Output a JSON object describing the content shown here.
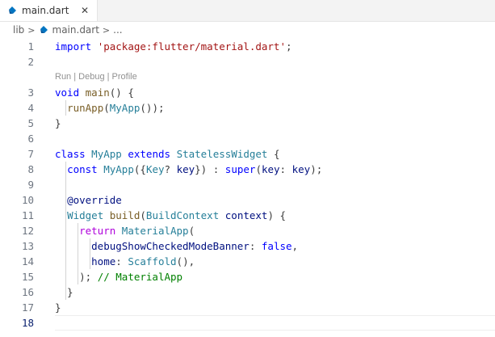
{
  "tab": {
    "filename": "main.dart",
    "icon": "dart-icon",
    "close_glyph": "✕"
  },
  "breadcrumb": {
    "folder": "lib",
    "sep1": ">",
    "file": "main.dart",
    "sep2": ">",
    "more": "..."
  },
  "codelens": "Run | Debug | Profile",
  "colors": {
    "keyword": "#0000ff",
    "control": "#af00db",
    "string": "#a31515",
    "type": "#267f99",
    "function": "#795e26",
    "variable": "#001080",
    "comment": "#008000",
    "dart": "#0175c2"
  },
  "lines": [
    {
      "n": "1",
      "t": [
        [
          "kw",
          "import"
        ],
        [
          "pl",
          " "
        ],
        [
          "str",
          "'package:flutter/material.dart'"
        ],
        [
          "pl",
          ";"
        ]
      ]
    },
    {
      "n": "2",
      "t": []
    },
    {
      "n": "3",
      "t": [
        [
          "kw",
          "void"
        ],
        [
          "pl",
          " "
        ],
        [
          "fn",
          "main"
        ],
        [
          "pl",
          "() {"
        ]
      ]
    },
    {
      "n": "4",
      "t": [
        [
          "pl",
          "  "
        ],
        [
          "fn",
          "runApp"
        ],
        [
          "pl",
          "("
        ],
        [
          "ty",
          "MyApp"
        ],
        [
          "pl",
          "());"
        ]
      ]
    },
    {
      "n": "5",
      "t": [
        [
          "pl",
          "}"
        ]
      ]
    },
    {
      "n": "6",
      "t": []
    },
    {
      "n": "7",
      "t": [
        [
          "kw",
          "class"
        ],
        [
          "pl",
          " "
        ],
        [
          "ty",
          "MyApp"
        ],
        [
          "pl",
          " "
        ],
        [
          "kw",
          "extends"
        ],
        [
          "pl",
          " "
        ],
        [
          "ty",
          "StatelessWidget"
        ],
        [
          "pl",
          " {"
        ]
      ]
    },
    {
      "n": "8",
      "t": [
        [
          "pl",
          "  "
        ],
        [
          "kw",
          "const"
        ],
        [
          "pl",
          " "
        ],
        [
          "ty",
          "MyApp"
        ],
        [
          "pl",
          "({"
        ],
        [
          "ty",
          "Key"
        ],
        [
          "pl",
          "? "
        ],
        [
          "vr",
          "key"
        ],
        [
          "pl",
          "}) : "
        ],
        [
          "kw",
          "super"
        ],
        [
          "pl",
          "("
        ],
        [
          "vr",
          "key"
        ],
        [
          "pl",
          ": "
        ],
        [
          "vr",
          "key"
        ],
        [
          "pl",
          ");"
        ]
      ]
    },
    {
      "n": "9",
      "t": []
    },
    {
      "n": "10",
      "t": [
        [
          "pl",
          "  "
        ],
        [
          "vr",
          "@override"
        ]
      ]
    },
    {
      "n": "11",
      "t": [
        [
          "pl",
          "  "
        ],
        [
          "ty",
          "Widget"
        ],
        [
          "pl",
          " "
        ],
        [
          "fn",
          "build"
        ],
        [
          "pl",
          "("
        ],
        [
          "ty",
          "BuildContext"
        ],
        [
          "pl",
          " "
        ],
        [
          "vr",
          "context"
        ],
        [
          "pl",
          ") {"
        ]
      ]
    },
    {
      "n": "12",
      "t": [
        [
          "pl",
          "    "
        ],
        [
          "ctl",
          "return"
        ],
        [
          "pl",
          " "
        ],
        [
          "ty",
          "MaterialApp"
        ],
        [
          "pl",
          "("
        ]
      ]
    },
    {
      "n": "13",
      "t": [
        [
          "pl",
          "      "
        ],
        [
          "vr",
          "debugShowCheckedModeBanner"
        ],
        [
          "pl",
          ": "
        ],
        [
          "kw",
          "false"
        ],
        [
          "pl",
          ","
        ]
      ]
    },
    {
      "n": "14",
      "t": [
        [
          "pl",
          "      "
        ],
        [
          "vr",
          "home"
        ],
        [
          "pl",
          ": "
        ],
        [
          "ty",
          "Scaffold"
        ],
        [
          "pl",
          "(),"
        ]
      ]
    },
    {
      "n": "15",
      "t": [
        [
          "pl",
          "    "
        ],
        [
          "pl",
          "); "
        ],
        [
          "cm",
          "// MaterialApp"
        ]
      ]
    },
    {
      "n": "16",
      "t": [
        [
          "pl",
          "  }"
        ]
      ]
    },
    {
      "n": "17",
      "t": [
        [
          "pl",
          "}"
        ]
      ]
    },
    {
      "n": "18",
      "t": []
    }
  ]
}
